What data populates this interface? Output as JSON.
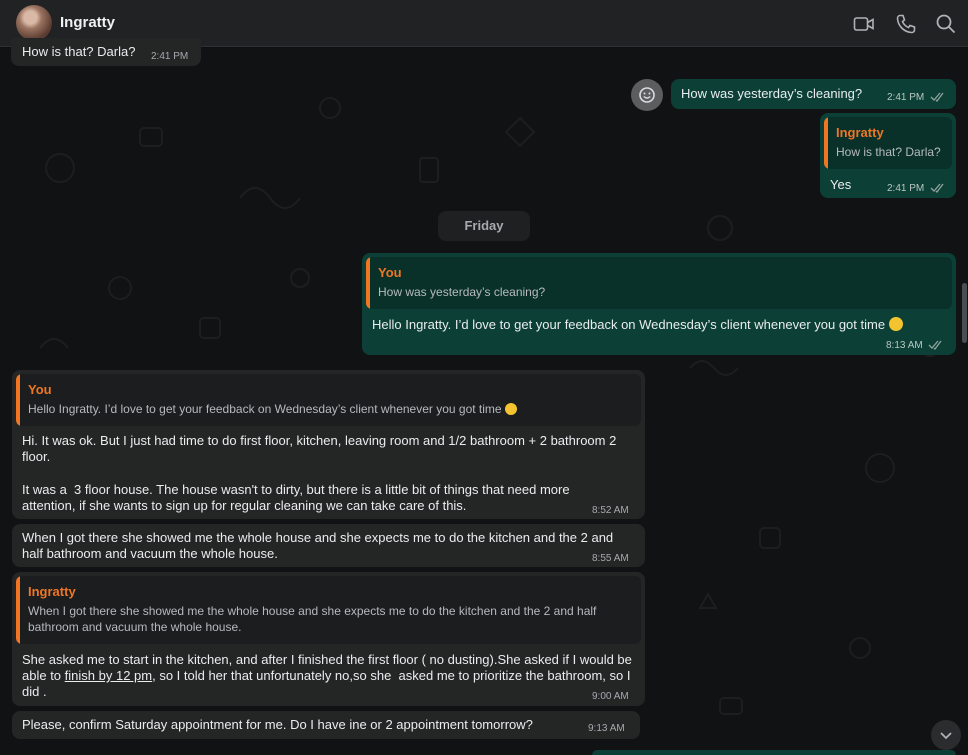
{
  "header": {
    "contact_name": "Ingratty",
    "icons": [
      "video-call-icon",
      "voice-call-icon",
      "search-icon"
    ]
  },
  "day_separator": "Friday",
  "messages": [
    {
      "id": "m0",
      "direction": "in",
      "text": "How is that? Darla?",
      "time": "2:41 PM"
    },
    {
      "id": "m1",
      "direction": "out",
      "text": "How was yesterday’s cleaning?",
      "time": "2:41 PM"
    },
    {
      "id": "m2",
      "direction": "out",
      "quote": {
        "author": "Ingratty",
        "text": "How is that? Darla?"
      },
      "text": "Yes",
      "time": "2:41 PM"
    },
    {
      "id": "m3",
      "direction": "out",
      "quote": {
        "author": "You",
        "text": "How was yesterday’s cleaning?"
      },
      "text": "Hello Ingratty. I’d love to get your feedback on Wednesday’s client whenever you got time",
      "time": "8:13 AM"
    },
    {
      "id": "m4",
      "direction": "in",
      "quote": {
        "author": "You",
        "text": "Hello Ingratty. I’d love to get your feedback on Wednesday’s client whenever you got time"
      },
      "text_1": "Hi. It was ok. But I just had time to do first floor, kitchen, leaving room and 1/2 bathroom + 2 bathroom 2 floor.",
      "text_2": "It was a  3 floor house. The house wasn't to dirty, but there is a little bit of things that need more attention, if she wants to sign up for regular cleaning we can take care of this.",
      "time": "8:52 AM"
    },
    {
      "id": "m5",
      "direction": "in",
      "text": "When I got there she showed me the whole house and she expects me to do the kitchen and the 2 and half bathroom and vacuum the whole house.",
      "time": "8:55 AM"
    },
    {
      "id": "m6",
      "direction": "in",
      "quote": {
        "author": "Ingratty",
        "text": "When I got there she showed me the whole house and she expects me to do the kitchen and the 2 and half bathroom and vacuum the whole house."
      },
      "text_before": "She asked me to start in the kitchen, and after I finished the first floor ( no dusting).She asked if I would be able to ",
      "text_link": "finish by 12 pm",
      "text_after": ", so I told her that unfortunately no,so she  asked me to prioritize the bathroom, so I did .",
      "time": "9:00 AM"
    },
    {
      "id": "m7",
      "direction": "in",
      "text": "Please, confirm Saturday appointment for me. Do I have ine or 2 appointment tomorrow?",
      "time": "9:13 AM"
    }
  ],
  "colors": {
    "incoming_bubble": "#242626",
    "outgoing_bubble": "#0c3f35",
    "quote_accent": "#f07623",
    "header": "#202223"
  }
}
